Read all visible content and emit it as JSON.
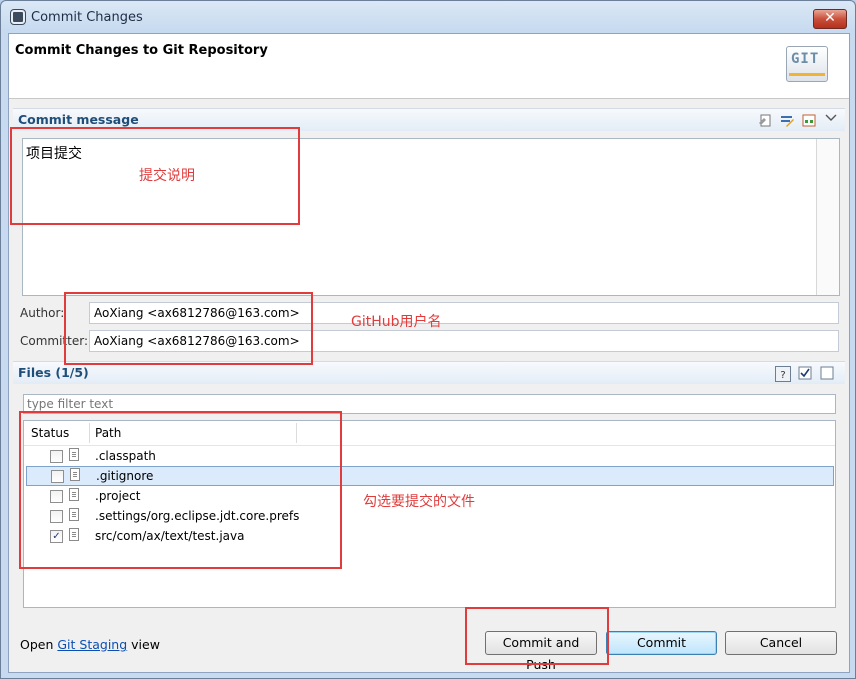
{
  "window": {
    "title": "Commit Changes",
    "close_glyph": "✕"
  },
  "header": {
    "title": "Commit Changes to Git Repository",
    "logo_text": "GIT"
  },
  "commit_message": {
    "section_title": "Commit message",
    "text": "项目提交",
    "toolbar_icons": [
      "sign-off-icon",
      "amend-icon",
      "changeid-icon",
      "menu-chevron-icon"
    ]
  },
  "author": {
    "label": "Author:",
    "value": "AoXiang <ax6812786@163.com>"
  },
  "committer": {
    "label": "Committer:",
    "value": "AoXiang <ax6812786@163.com>"
  },
  "files": {
    "section_title": "Files (1/5)",
    "filter_placeholder": "type filter text",
    "columns": [
      "Status",
      "Path"
    ],
    "rows": [
      {
        "path": ".classpath",
        "checked": false,
        "selected": false
      },
      {
        "path": ".gitignore",
        "checked": false,
        "selected": true
      },
      {
        "path": ".project",
        "checked": false,
        "selected": false
      },
      {
        "path": ".settings/org.eclipse.jdt.core.prefs",
        "checked": false,
        "selected": false
      },
      {
        "path": "src/com/ax/text/test.java",
        "checked": true,
        "selected": false
      }
    ]
  },
  "footer": {
    "open_text": "Open",
    "staging_link": "Git Staging",
    "view_text": "view",
    "buttons": {
      "commit_and_push": "Commit and Push",
      "commit": "Commit",
      "cancel": "Cancel"
    }
  },
  "annotations": {
    "message_note": "提交说明",
    "user_note": "GitHub用户名",
    "files_note": "勾选要提交的文件"
  },
  "colors": {
    "annotation": "#e03c3c",
    "accent": "#1f4e79",
    "link": "#0b4fb3"
  }
}
